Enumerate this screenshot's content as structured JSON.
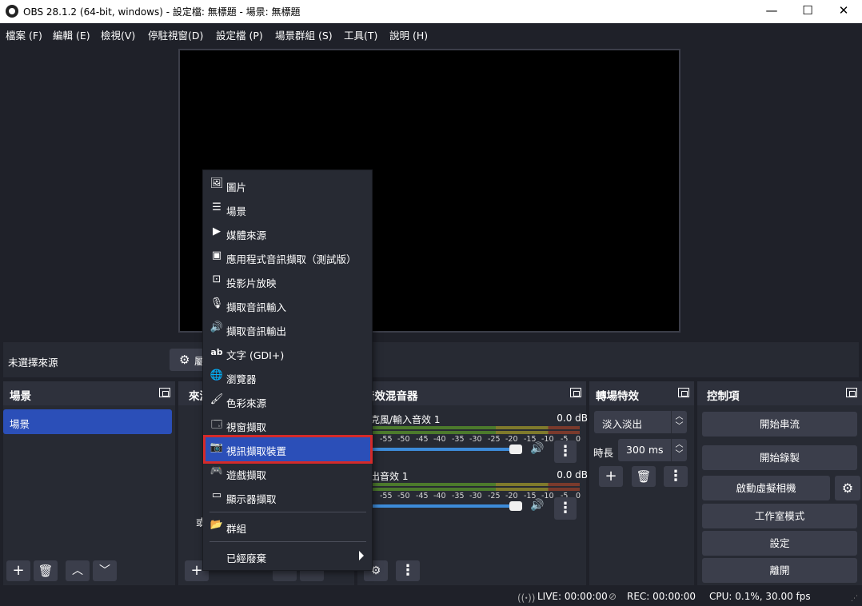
{
  "window": {
    "title": "OBS 28.1.2 (64-bit, windows) - 設定檔: 無標題 - 場景: 無標題",
    "min": "—",
    "max": "☐",
    "close": "✕"
  },
  "menu": [
    "檔案 (F)",
    "編輯 (E)",
    "檢視(V)",
    "停駐視窗(D)",
    "設定檔 (P)",
    "場景群組 (S)",
    "工具(T)",
    "說明 (H)"
  ],
  "source_bar": {
    "no_selection": "未選擇來源",
    "properties_label": "屬"
  },
  "scenes": {
    "title": "場景",
    "items": [
      "場景"
    ]
  },
  "sources": {
    "title_partial": "來源",
    "hint_partial": "或"
  },
  "mixer": {
    "title": "音效混音器",
    "tracks": [
      {
        "name": "克風/輸入音效 1",
        "db": "0.0 dB"
      },
      {
        "name": "出音效 1",
        "db": "0.0 dB"
      }
    ],
    "ticks": [
      "-55",
      "-50",
      "-45",
      "-40",
      "-35",
      "-30",
      "-25",
      "-20",
      "-15",
      "-10",
      "-5",
      "0"
    ]
  },
  "transitions": {
    "title": "轉場特效",
    "selected": "淡入淡出",
    "duration_label": "時長",
    "duration_value": "300 ms"
  },
  "controls": {
    "title": "控制項",
    "buttons": [
      "開始串流",
      "開始錄製",
      "啟動虛擬相機",
      "工作室模式",
      "設定",
      "離開"
    ]
  },
  "status": {
    "live": "LIVE: 00:00:00",
    "rec": "REC: 00:00:00",
    "cpu": "CPU: 0.1%, 30.00 fps"
  },
  "context_menu": {
    "items": [
      {
        "icon": "image-icon",
        "label": "圖片"
      },
      {
        "icon": "list-icon",
        "label": "場景"
      },
      {
        "icon": "play-icon",
        "label": "媒體來源"
      },
      {
        "icon": "app-audio-icon",
        "label": "應用程式音訊擷取（測試版）"
      },
      {
        "icon": "slideshow-icon",
        "label": "投影片放映"
      },
      {
        "icon": "microphone-icon",
        "label": "擷取音訊輸入"
      },
      {
        "icon": "speaker-icon",
        "label": "擷取音訊輸出"
      },
      {
        "icon": "text-icon",
        "label": "文字 (GDI+)"
      },
      {
        "icon": "globe-icon",
        "label": "瀏覽器"
      },
      {
        "icon": "brush-icon",
        "label": "色彩來源"
      },
      {
        "icon": "window-icon",
        "label": "視窗擷取"
      },
      {
        "icon": "camera-icon",
        "label": "視訊擷取裝置"
      },
      {
        "icon": "gamepad-icon",
        "label": "遊戲擷取"
      },
      {
        "icon": "monitor-icon",
        "label": "顯示器擷取"
      },
      {
        "icon": "folder-icon",
        "label": "群組"
      },
      {
        "icon": "",
        "label": "已經廢棄"
      }
    ],
    "selected_index": 11
  }
}
